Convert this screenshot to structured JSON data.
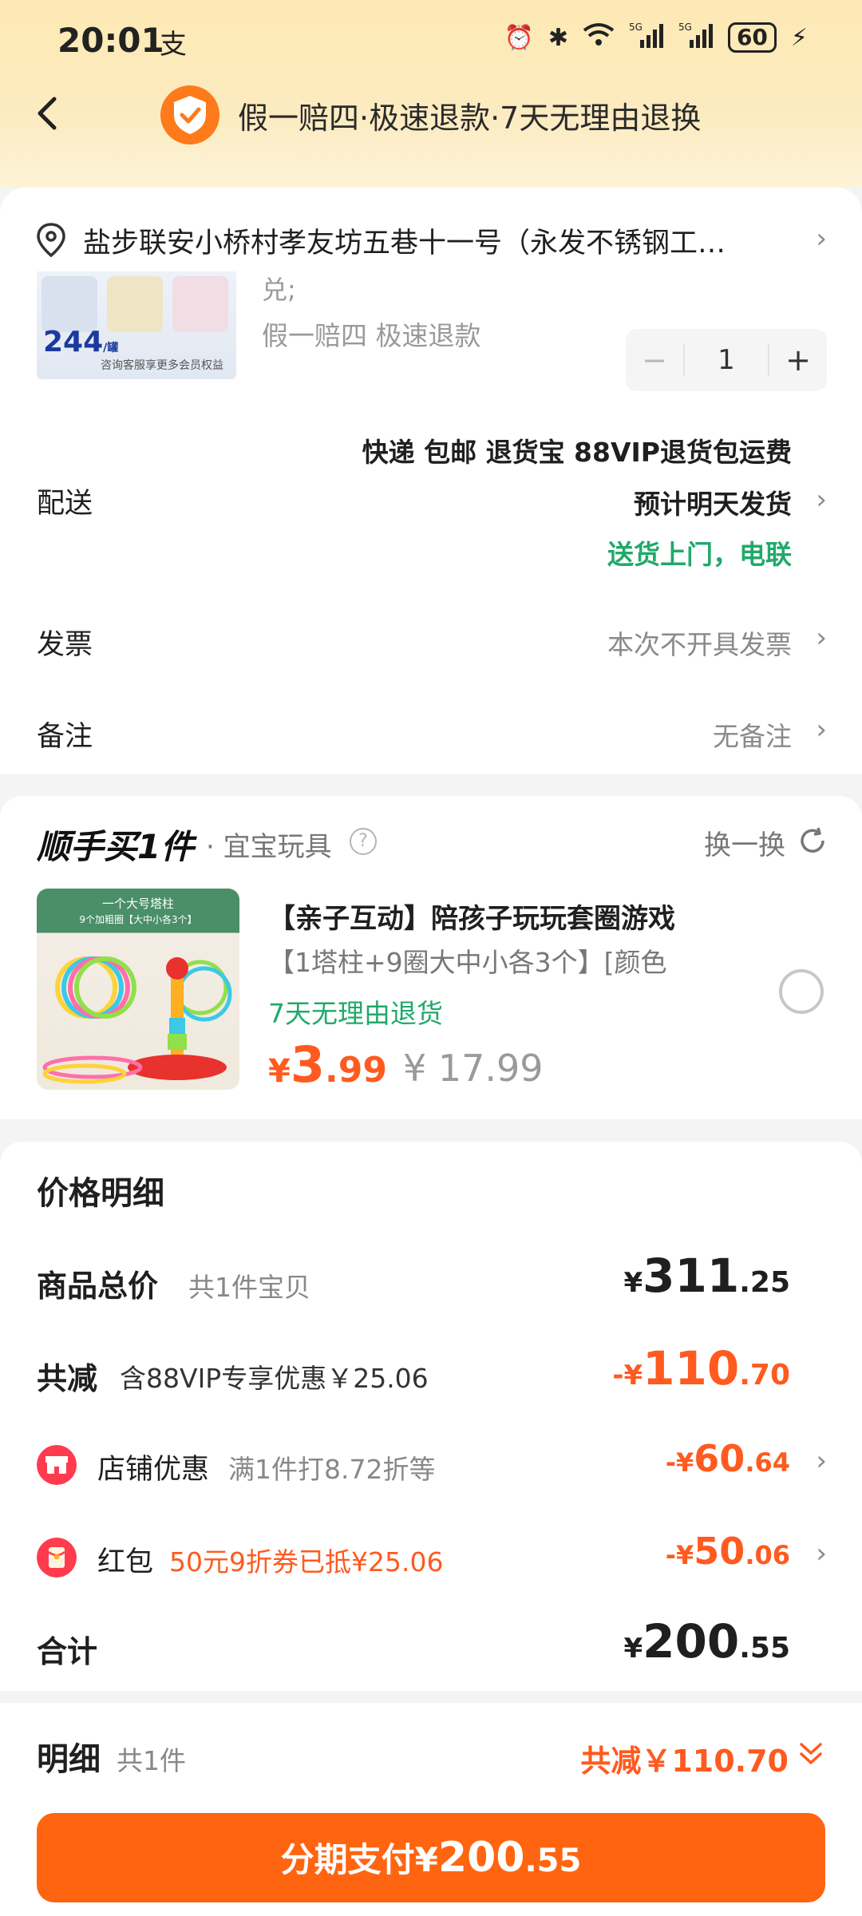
{
  "status_bar": {
    "time": "20:01",
    "pay_glyph": "支",
    "battery": "60",
    "network": "5G"
  },
  "header": {
    "trust_text": "假一赔四·极速退款·7天无理由退换"
  },
  "address": {
    "text": "盐步联安小桥村孝友坊五巷十一号（永发不锈钢工…"
  },
  "product": {
    "title_tail": "兑;",
    "service_tags": "假一赔四  极速退款",
    "image_price": "244",
    "image_price_unit": "/罐",
    "image_caption": "咨询客服享更多会员权益",
    "quantity": "1",
    "minus": "−",
    "plus": "+"
  },
  "delivery": {
    "label": "配送",
    "line1": "快递 包邮 退货宝 88VIP退货包运费",
    "line2": "预计明天发货",
    "line3": "送货上门，电联"
  },
  "invoice": {
    "label": "发票",
    "value": "本次不开具发票"
  },
  "remark": {
    "label": "备注",
    "value": "无备注"
  },
  "shunshou": {
    "logo": "顺手买1件",
    "shop": "· 宜宝玩具",
    "help": "?",
    "swap_label": "换一换",
    "image_top": "一个大号塔柱",
    "image_sub": "9个加粗圈【大中小各3个】",
    "title": "【亲子互动】陪孩子玩玩套圈游戏",
    "spec": "【1塔柱+9圈大中小各3个】[颜色",
    "badge": "7天无理由退货",
    "price_currency": "¥",
    "price_int": "3",
    "price_dec": ".99",
    "orig_price": "¥ 17.99"
  },
  "price_detail": {
    "title": "价格明细",
    "total": {
      "label": "商品总价",
      "sub": "共1件宝贝",
      "currency": "¥",
      "int": "311",
      "dec": ".25"
    },
    "reduce": {
      "label": "共减",
      "sub": "含88VIP专享优惠￥25.06",
      "prefix": "-¥",
      "int": "110",
      "dec": ".70"
    },
    "shop_discount": {
      "label": "店铺优惠",
      "sub": "满1件打8.72折等",
      "prefix": "-¥",
      "int": "60",
      "dec": ".64"
    },
    "red_packet": {
      "label": "红包",
      "sub": "50元9折券已抵¥25.06",
      "prefix": "-¥",
      "int": "50",
      "dec": ".06"
    },
    "sum": {
      "label": "合计",
      "currency": "¥",
      "int": "200",
      "dec": ".55"
    }
  },
  "bottom": {
    "label": "明细",
    "count": "共1件",
    "discount": "共减￥110.70",
    "pay_label": "分期支付¥",
    "pay_int": "200",
    "pay_dec": ".55"
  },
  "colors": {
    "accent": "#ff6510",
    "green": "#22a96a",
    "header_bg": "#fde9b4"
  },
  "icons": [
    "back-arrow-icon",
    "shield-check-icon",
    "location-pin-icon",
    "chevron-right-icon",
    "help-icon",
    "refresh-icon",
    "store-icon",
    "red-packet-icon",
    "double-chevron-down-icon"
  ]
}
